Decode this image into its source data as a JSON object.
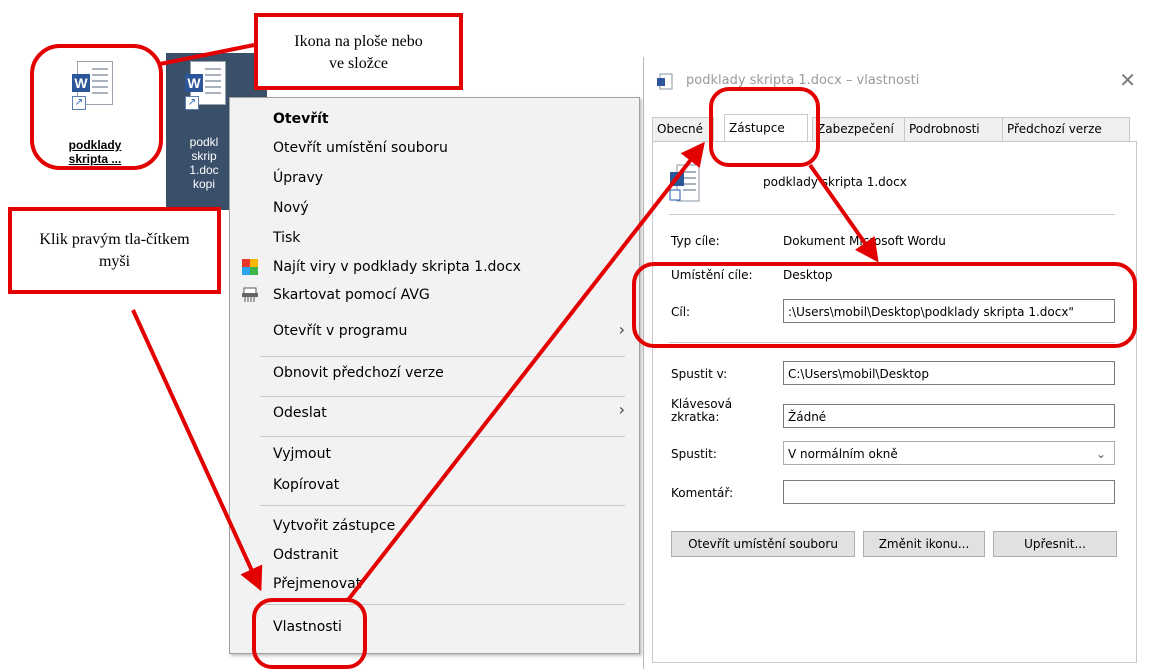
{
  "desktop": {
    "icon1_label": "podklady skripta ...",
    "icon2_lines": [
      "podkl",
      "skrip",
      "1.doc",
      "kopi"
    ]
  },
  "annotations": {
    "icon_callout": "Ikona na ploše nebo ve složce",
    "rightclick_callout": "Klik pravým tla-čítkem myši"
  },
  "context_menu": {
    "items": [
      {
        "label": "Otevřít"
      },
      {
        "label": "Otevřít umístění souboru"
      },
      {
        "label": "Úpravy"
      },
      {
        "label": "Nový"
      },
      {
        "label": "Tisk"
      },
      {
        "label": "Najít viry v podklady skripta 1.docx"
      },
      {
        "label": "Skartovat pomocí AVG"
      },
      {
        "label": "Otevřít v programu"
      },
      {
        "label": "Obnovit předchozí verze"
      },
      {
        "label": "Odeslat"
      },
      {
        "label": "Vyjmout"
      },
      {
        "label": "Kopírovat"
      },
      {
        "label": "Vytvořit zástupce"
      },
      {
        "label": "Odstranit"
      },
      {
        "label": "Přejmenovat"
      },
      {
        "label": "Vlastnosti"
      }
    ],
    "chevron": "›"
  },
  "dialog": {
    "title": "podklady skripta 1.docx – vlastnosti",
    "close": "✕",
    "tabs": [
      "Obecné",
      "Zástupce",
      "Zabezpečení",
      "Podrobnosti",
      "Předchozí verze"
    ],
    "active_tab": "Zástupce",
    "file_name": "podklady skripta 1.docx",
    "target_type_label": "Typ cíle:",
    "target_type_value": "Dokument Microsoft Wordu",
    "target_location_label": "Umístění cíle:",
    "target_location_value": "Desktop",
    "target_label": "Cíl:",
    "target_value": ":\\Users\\mobil\\Desktop\\podklady skripta 1.docx\"",
    "start_in_label": "Spustit v:",
    "start_in_value": "C:\\Users\\mobil\\Desktop",
    "shortcut_key_label": "Klávesová zkratka:",
    "shortcut_key_value": "Žádné",
    "run_label": "Spustit:",
    "run_value": "V normálním okně",
    "comment_label": "Komentář:",
    "comment_value": "",
    "buttons": [
      "Otevřít umístění souboru",
      "Změnit ikonu...",
      "Upřesnit..."
    ]
  },
  "colors": {
    "annotation_red": "#e30000",
    "word_blue": "#2b579a",
    "selection_blue": "#3a4f69"
  }
}
